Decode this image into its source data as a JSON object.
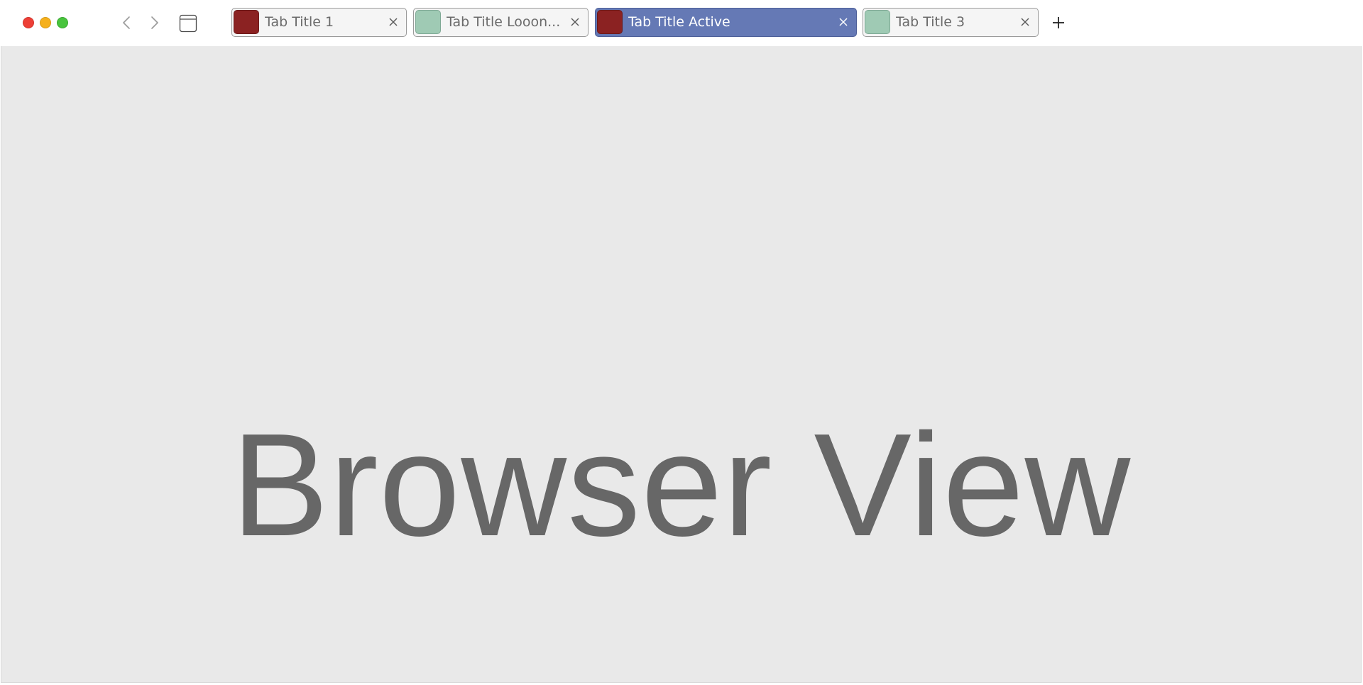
{
  "window": {
    "controls": [
      "close",
      "minimize",
      "zoom"
    ]
  },
  "toolbar": {
    "back_icon": "chevron-left-icon",
    "forward_icon": "chevron-right-icon",
    "sidebar_icon": "sidebar-toggle-icon",
    "new_tab_icon": "plus-icon"
  },
  "tabs": [
    {
      "title": "Tab Title 1",
      "favicon_color": "#8b2222",
      "active": false
    },
    {
      "title": "Tab Title Looon...",
      "favicon_color": "#9fcab4",
      "active": false
    },
    {
      "title": "Tab Title Active",
      "favicon_color": "#8b2222",
      "active": true
    },
    {
      "title": "Tab Title 3",
      "favicon_color": "#9fcab4",
      "active": false
    }
  ],
  "colors": {
    "active_tab": "#6579b5",
    "inactive_tab": "#f5f5f5",
    "view_background": "#e9e9e9"
  },
  "view": {
    "label": "Browser View"
  }
}
